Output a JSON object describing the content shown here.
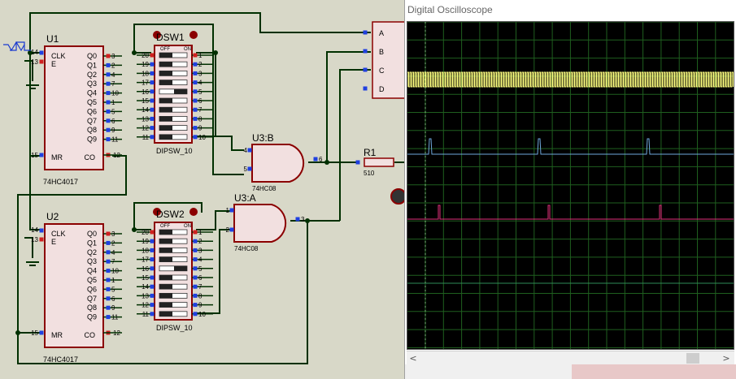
{
  "u1": {
    "ref": "U1",
    "part": "74HC4017",
    "pins_left": [
      "CLK",
      "E",
      "MR"
    ],
    "outputs": [
      "Q0",
      "Q1",
      "Q2",
      "Q3",
      "Q4",
      "Q5",
      "Q6",
      "Q7",
      "Q8",
      "Q9",
      "CO"
    ],
    "pin_clk": "14",
    "pin_e": "13",
    "pin_mr": "15",
    "pin_co": "12",
    "out_pins": [
      "3",
      "2",
      "4",
      "7",
      "10",
      "1",
      "5",
      "6",
      "9",
      "11"
    ]
  },
  "u2": {
    "ref": "U2",
    "part": "74HC4017",
    "pin_clk": "14",
    "pin_e": "13",
    "pin_mr": "15",
    "pin_co": "12",
    "out_pins": [
      "3",
      "2",
      "4",
      "7",
      "10",
      "1",
      "5",
      "6",
      "9",
      "11"
    ]
  },
  "dsw1": {
    "ref": "DSW1",
    "part": "DIPSW_10",
    "off": "OFF",
    "on": "ON",
    "left_pins": [
      "20",
      "19",
      "18",
      "17",
      "16",
      "15",
      "14",
      "13",
      "12",
      "11"
    ],
    "right_pins": [
      "1",
      "2",
      "3",
      "4",
      "5",
      "6",
      "7",
      "8",
      "9",
      "10"
    ]
  },
  "dsw2": {
    "ref": "DSW2",
    "part": "DIPSW_10",
    "off": "OFF",
    "on": "ON",
    "left_pins": [
      "20",
      "19",
      "18",
      "17",
      "16",
      "15",
      "14",
      "13",
      "12",
      "11"
    ],
    "right_pins": [
      "1",
      "2",
      "3",
      "4",
      "5",
      "6",
      "7",
      "8",
      "9",
      "10"
    ]
  },
  "u3b": {
    "ref": "U3:B",
    "part": "74HC08",
    "pin_a": "4",
    "pin_b": "5",
    "pin_out": "6"
  },
  "u3a": {
    "ref": "U3:A",
    "part": "74HC08",
    "pin_a": "1",
    "pin_b": "2",
    "pin_out": "3"
  },
  "r1": {
    "ref": "R1",
    "value": "510"
  },
  "scope_inputs": [
    "A",
    "B",
    "C",
    "D"
  ],
  "oscilloscope": {
    "title": "Digital Oscilloscope",
    "trace_colors": {
      "a": "#ffff80",
      "b": "#6fa8dc",
      "c": "#e0307a",
      "d": "#2e8b57"
    },
    "grid_color": "#1f5f1f",
    "scroll_left": "<",
    "scroll_right": ">"
  }
}
